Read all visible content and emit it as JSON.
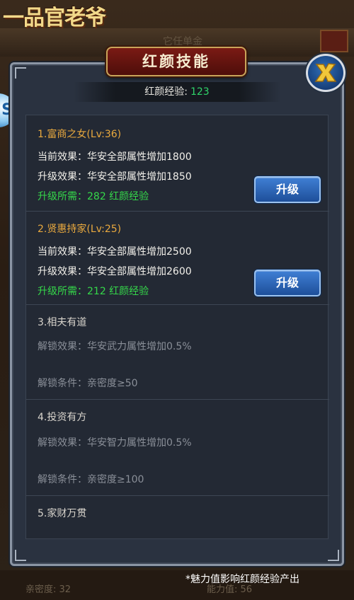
{
  "background": {
    "logo_text": "一品官老爷",
    "tab_text": "它任单金",
    "stat_left": "亲密度: 32",
    "stat_right": "能力值: 56"
  },
  "dialog": {
    "title": "红颜技能",
    "exp_label": "红颜经验:",
    "exp_value": "123"
  },
  "skills": [
    {
      "title": "1.富商之女(Lv:36)",
      "current_effect": "当前效果：华安全部属性增加1800",
      "upgrade_effect": "升级效果：华安全部属性增加1850",
      "requirement": "升级所需：282 红颜经验",
      "button_label": "升级"
    },
    {
      "title": "2.贤惠持家(Lv:25)",
      "current_effect": "当前效果：华安全部属性增加2500",
      "upgrade_effect": "升级效果：华安全部属性增加2600",
      "requirement": "升级所需：212 红颜经验",
      "button_label": "升级"
    }
  ],
  "locked_skills": [
    {
      "title": "3.相夫有道",
      "unlock_effect": "解锁效果：华安武力属性增加0.5%",
      "unlock_condition": "解锁条件：亲密度≥50"
    },
    {
      "title": "4.投资有方",
      "unlock_effect": "解锁效果：华安智力属性增加0.5%",
      "unlock_condition": "解锁条件：亲密度≥100"
    },
    {
      "title": "5.家财万贯"
    }
  ],
  "footer_note": "*魅力值影响红颜经验产出",
  "colors": {
    "active_title": "#e9a93e",
    "requirement_green": "#35d84a",
    "exp_green": "#2fd46a",
    "button_blue": "#2f6fc0",
    "title_red": "#6a1410"
  },
  "icons": {
    "close": "close-x-icon",
    "side": "side-bubble-icon"
  }
}
